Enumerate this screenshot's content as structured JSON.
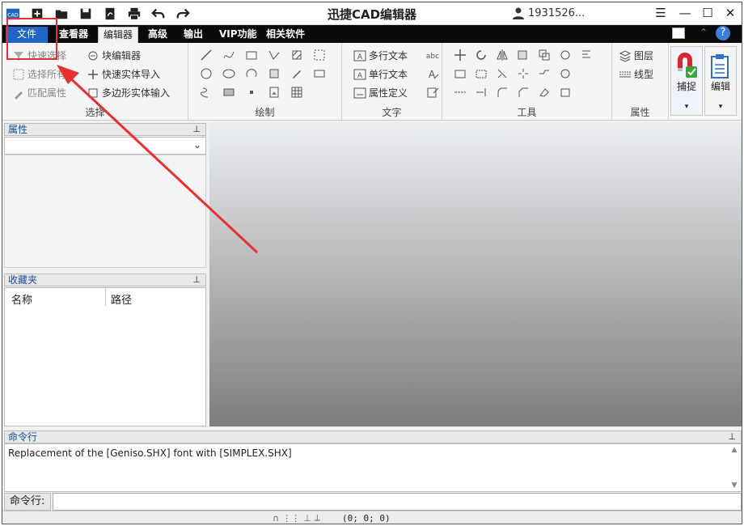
{
  "app": {
    "title": "迅捷CAD编辑器",
    "logo_text": "CAD",
    "user": "1931526..."
  },
  "quick_access": [
    "new-icon",
    "open-folder-icon",
    "save-icon",
    "pdf-icon",
    "print-icon",
    "undo-icon",
    "redo-icon"
  ],
  "window_controls": [
    "menu-icon",
    "minimize-icon",
    "maximize-icon",
    "close-icon"
  ],
  "tabs": {
    "file": "文件",
    "viewer": "查看器",
    "editor": "编辑器",
    "advanced": "高级",
    "output": "输出",
    "vip": "VIP功能",
    "related": "相关软件"
  },
  "ribbon": {
    "select": {
      "label": "选择",
      "quick_select": "快速选择",
      "select_all": "选择所有",
      "match_props": "匹配属性",
      "block_editor": "块编辑器",
      "quick_solid_import": "快速实体导入",
      "polygon_solid_input": "多边形实体输入"
    },
    "draw": {
      "label": "绘制"
    },
    "text": {
      "label": "文字",
      "mtext": "多行文本",
      "stext": "单行文本",
      "attr_def": "属性定义"
    },
    "tools": {
      "label": "工具"
    },
    "props": {
      "label": "属性",
      "layers": "图层",
      "linetype": "线型"
    },
    "snap": "捕捉",
    "edit": "编辑"
  },
  "panels": {
    "properties": "属性",
    "favorites": "收藏夹",
    "fav_columns": [
      "名称",
      "路径"
    ]
  },
  "command": {
    "header": "命令行",
    "output": "Replacement of the [Geniso.SHX] font with [SIMPLEX.SHX]",
    "input_label": "命令行:",
    "input_value": ""
  },
  "status": {
    "coords": "(0; 0; 0)"
  },
  "colors": {
    "accent": "#1e66c8",
    "annotation": "#e8302e"
  }
}
